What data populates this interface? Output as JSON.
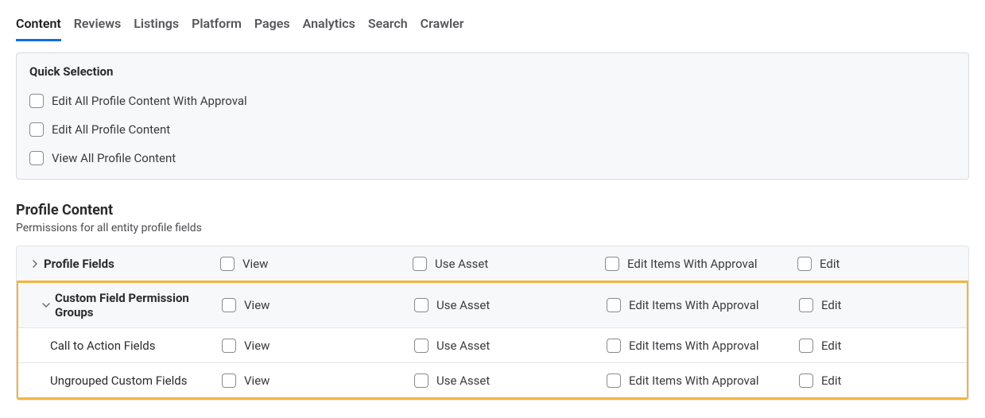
{
  "tabs": {
    "content": "Content",
    "reviews": "Reviews",
    "listings": "Listings",
    "platform": "Platform",
    "pages": "Pages",
    "analytics": "Analytics",
    "search": "Search",
    "crawler": "Crawler"
  },
  "quick": {
    "title": "Quick Selection",
    "edit_all_approval": "Edit All Profile Content With Approval",
    "edit_all": "Edit All Profile Content",
    "view_all": "View All Profile Content"
  },
  "section": {
    "title": "Profile Content",
    "sub": "Permissions for all entity profile fields"
  },
  "cols": {
    "view": "View",
    "use_asset": "Use Asset",
    "edit_approval": "Edit Items With Approval",
    "edit": "Edit"
  },
  "rows": {
    "profile_fields": "Profile Fields",
    "cfpg": "Custom Field Permission Groups",
    "cta": "Call to Action Fields",
    "ungrouped": "Ungrouped Custom Fields"
  }
}
